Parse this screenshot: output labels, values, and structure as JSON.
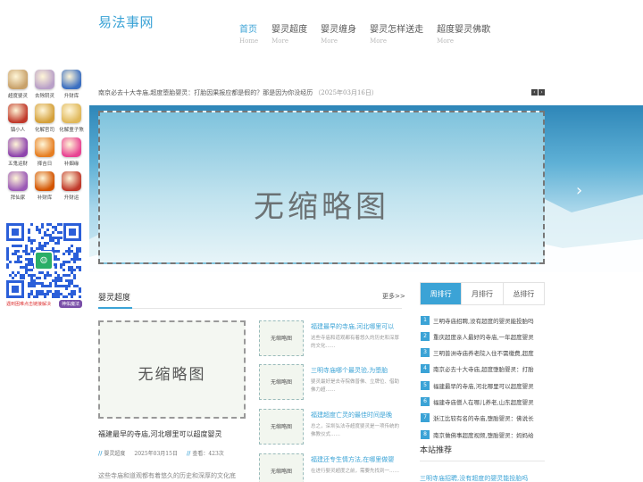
{
  "site": {
    "logo": "易法事网"
  },
  "nav": [
    {
      "title": "首页",
      "sub": "Home",
      "active": true
    },
    {
      "title": "婴灵超度",
      "sub": "More"
    },
    {
      "title": "婴灵缠身",
      "sub": "More"
    },
    {
      "title": "婴灵怎样送走",
      "sub": "More"
    },
    {
      "title": "超度婴灵佛歌",
      "sub": "More"
    }
  ],
  "apps": [
    {
      "label": "超度婴灵",
      "color": "#c8a16a"
    },
    {
      "label": "去除阴灵",
      "color": "#b9a0c8"
    },
    {
      "label": "升财库",
      "color": "#3b6fc1"
    },
    {
      "label": "镇小人",
      "color": "#c0392b"
    },
    {
      "label": "化解官司",
      "color": "#d4a03a"
    },
    {
      "label": "化解童子煞",
      "color": "#e0b85a"
    },
    {
      "label": "五鬼运财",
      "color": "#8e44ad"
    },
    {
      "label": "择吉日",
      "color": "#e67e22"
    },
    {
      "label": "补姻缘",
      "color": "#e84393"
    },
    {
      "label": "拜仙家",
      "color": "#9b59b6"
    },
    {
      "label": "补财库",
      "color": "#d35400"
    },
    {
      "label": "升财运",
      "color": "#c0392b"
    }
  ],
  "qr": {
    "caption_left": "遇到困难点击链接解决",
    "caption_right": "神佑魔法"
  },
  "ticker": {
    "text": "南京必去十大寺庙,超度堕胎婴灵：打胎因果报应都是假的？那是因为你没经历",
    "date": "（2025年03月16日）",
    "prev": "‹",
    "next": "›"
  },
  "banner": {
    "thumb_text": "无缩略图",
    "next": "›"
  },
  "section": {
    "title": "婴灵超度",
    "more": "更多>>"
  },
  "featured": {
    "thumb_text": "无缩略图",
    "title": "福建最早的寺庙,河北哪里可以超度婴灵",
    "category": "婴灵超度",
    "date": "2025年03月15日",
    "views": "查看：423次",
    "desc": "这些寺庙和道观都有着悠久的历史和深厚的文化底"
  },
  "articles": [
    {
      "thumb": "无缩略图",
      "title": "福建最早的寺庙,河北哪里可以",
      "desc": "这些寺庙和道观都有着悠久的历史和深厚的文化……"
    },
    {
      "thumb": "无缩略图",
      "title": "三明寺庙哪个最灵验,为堕胎",
      "desc": "婴灵最好是去寺院做普佛、立牌位、借助佛力超……"
    },
    {
      "thumb": "无缩略图",
      "title": "福建超度亡灵的最佳时间是晚",
      "desc": "总之，深圳弘法寺超度婴灵是一项传统的佛教仪式……"
    },
    {
      "thumb": "无缩略图",
      "title": "福建还专生情方法,在哪里做婴",
      "desc": "在进行婴灵超度之前，需要先找到一……"
    }
  ],
  "ranking": {
    "tabs": [
      "周排行",
      "月排行",
      "总排行"
    ],
    "items": [
      "三明寺庙招聘,没有超度的婴灵能投胎吗",
      "重庆超度亲人最好的寺庙,一年超度婴灵",
      "三明普洲寺庙养老院入住不需缴费,超度",
      "南京必去十大寺庙,超度堕胎婴灵：打胎",
      "福建最早的寺庙,河北哪里可以超度婴灵",
      "福建寺庙僧人在哪儿养老,山东超度婴灵",
      "浙江比较有名的寺庙,堕胎婴灵：佛说长",
      "南京做佛事超度视频,堕胎婴灵：妈妈给"
    ]
  },
  "recommend": {
    "title": "本站推荐",
    "first": "三明寺庙招聘,没有超度的婴灵能投胎吗"
  }
}
